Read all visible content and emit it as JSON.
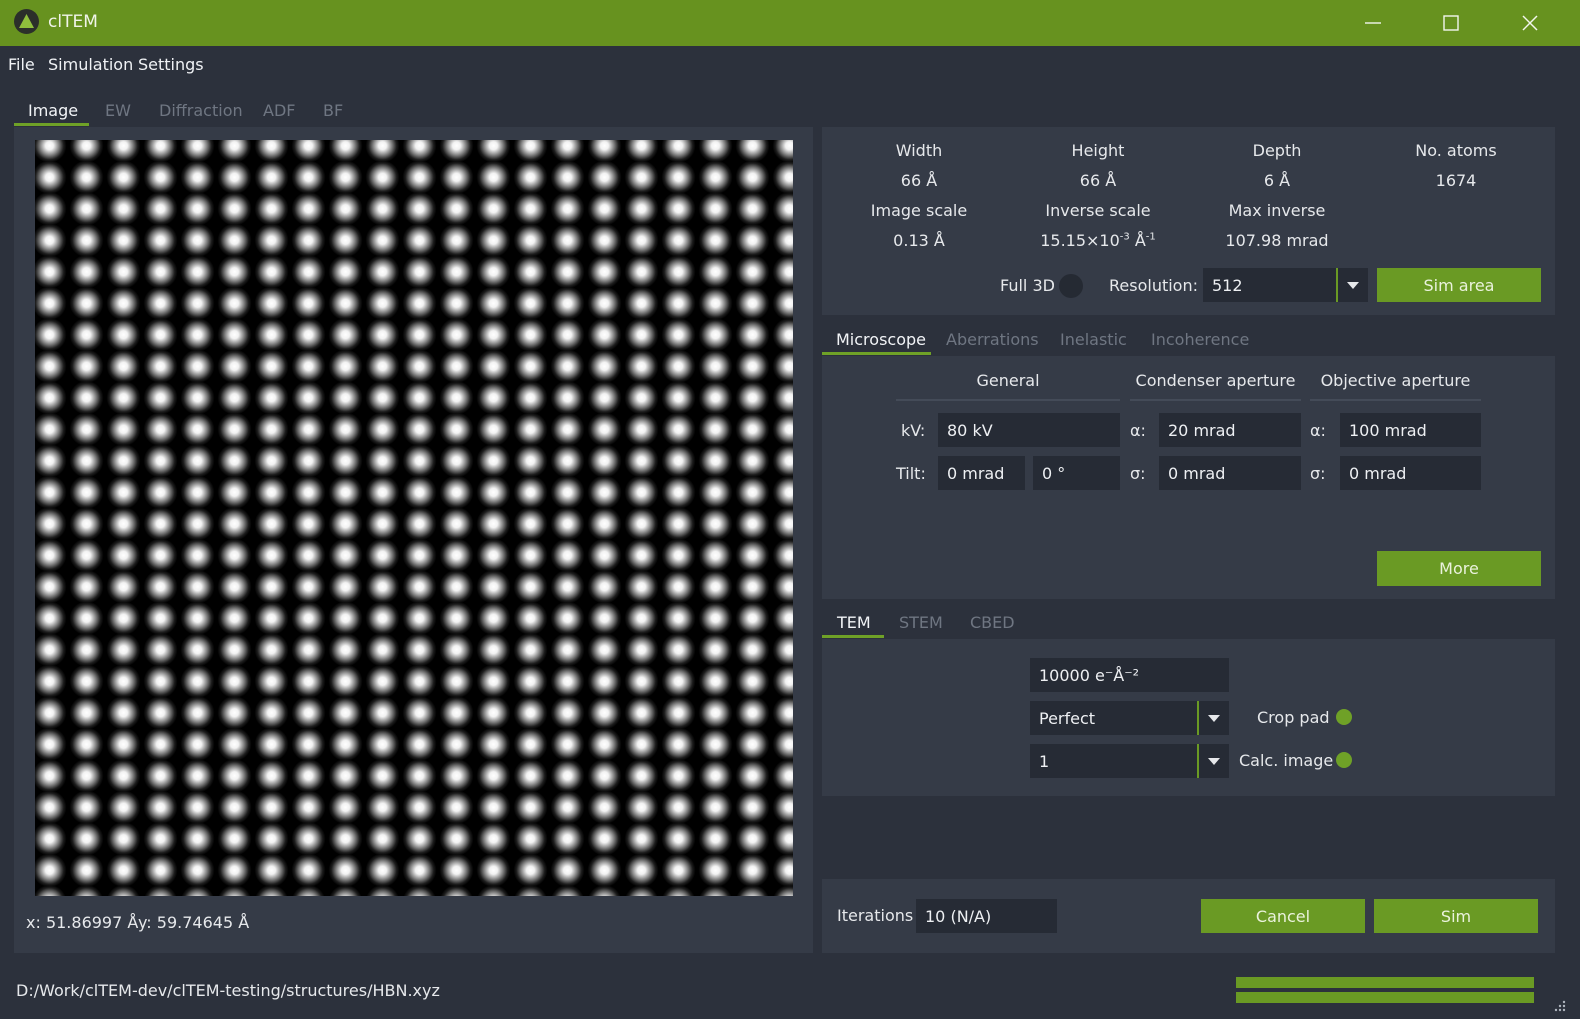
{
  "window": {
    "title": "clTEM"
  },
  "menu": {
    "items": [
      "File",
      "Simulation",
      "Settings"
    ]
  },
  "image_tabs": [
    "Image",
    "EW",
    "Diffraction",
    "ADF",
    "BF"
  ],
  "cursor_readout": {
    "x": "x: 51.86997 Å",
    "y": "y: 59.74645 Å"
  },
  "info": {
    "width_label": "Width",
    "width_value": "66 Å",
    "height_label": "Height",
    "height_value": "66 Å",
    "depth_label": "Depth",
    "depth_value": "6 Å",
    "atoms_label": "No. atoms",
    "atoms_value": "1674",
    "image_scale_label": "Image scale",
    "image_scale_value": "0.13 Å",
    "inverse_scale_label": "Inverse scale",
    "inverse_scale_main": "15.15×10",
    "inverse_scale_exp": "-3",
    "inverse_scale_unit": " Å",
    "inverse_scale_unit_exp": "-1",
    "max_inverse_label": "Max inverse",
    "max_inverse_value": "107.98 mrad",
    "full3d_label": "Full 3D",
    "resolution_label": "Resolution:",
    "resolution_value": "512",
    "sim_area_button": "Sim area"
  },
  "microscope_tabs": [
    "Microscope",
    "Aberrations",
    "Inelastic",
    "Incoherence"
  ],
  "microscope": {
    "general_header": "General",
    "condenser_header": "Condenser aperture",
    "objective_header": "Objective aperture",
    "kv_label": "kV:",
    "kv_value": "80 kV",
    "tilt_label": "Tilt:",
    "tilt_value": "0 mrad",
    "tilt_angle": "0 °",
    "cond_alpha_label": "α:",
    "cond_alpha_value": "20 mrad",
    "cond_sigma_label": "σ:",
    "cond_sigma_value": "0 mrad",
    "obj_alpha_label": "α:",
    "obj_alpha_value": "100 mrad",
    "obj_sigma_label": "σ:",
    "obj_sigma_value": "0 mrad",
    "more_button": "More"
  },
  "mode_tabs": [
    "TEM",
    "STEM",
    "CBED"
  ],
  "tem": {
    "dose_value": "10000 e⁻Å⁻²",
    "ccd_value": "Perfect",
    "binning_value": "1",
    "crop_pad_label": "Crop pad",
    "calc_image_label": "Calc. image"
  },
  "footer": {
    "iterations_label": "Iterations",
    "iterations_value": "10 (N/A)",
    "cancel_button": "Cancel",
    "sim_button": "Sim"
  },
  "status": {
    "file_path": "D:/Work/clTEM-dev/clTEM-testing/structures/HBN.xyz"
  },
  "colors": {
    "accent": "#6a9a24",
    "titlebar": "#67921f",
    "background": "#2c313c",
    "panel": "#353b47",
    "field": "#262b35"
  }
}
